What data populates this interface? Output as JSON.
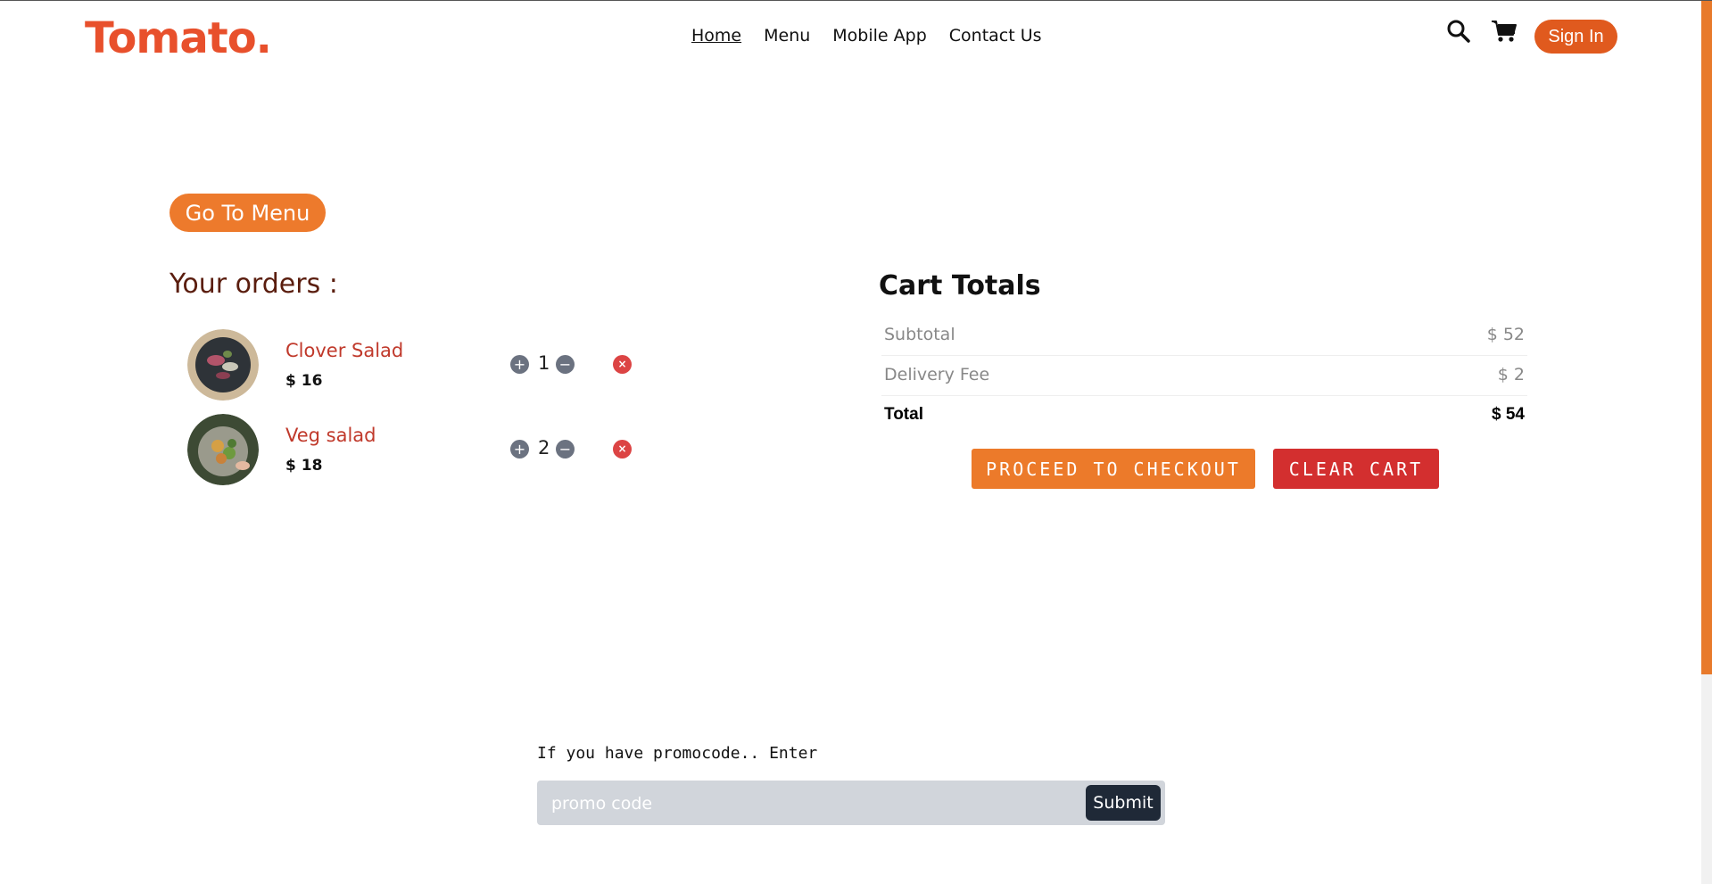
{
  "brand": {
    "logo": "Tomato."
  },
  "nav": {
    "items": [
      "Home",
      "Menu",
      "Mobile App",
      "Contact Us"
    ],
    "active": "Home"
  },
  "header": {
    "signin_label": "Sign In"
  },
  "orders": {
    "go_menu_label": "Go To Menu",
    "title": "Your orders :",
    "items": [
      {
        "name": "Clover Salad",
        "price": "$ 16",
        "qty": "1"
      },
      {
        "name": "Veg salad",
        "price": "$ 18",
        "qty": "2"
      }
    ]
  },
  "cart_totals": {
    "title": "Cart Totals",
    "subtotal_label": "Subtotal",
    "subtotal_value": "$ 52",
    "delivery_label": "Delivery Fee",
    "delivery_value": "$ 2",
    "total_label": "Total",
    "total_value": "$ 54",
    "checkout_label": "PROCEED TO CHECKOUT",
    "clear_label": "CLEAR CART"
  },
  "promo": {
    "label": "If you have promocode.. Enter",
    "placeholder": "promo code",
    "submit_label": "Submit"
  },
  "colors": {
    "accent": "#ed7a2c",
    "danger": "#d32f2f",
    "brand": "#e8502c"
  }
}
